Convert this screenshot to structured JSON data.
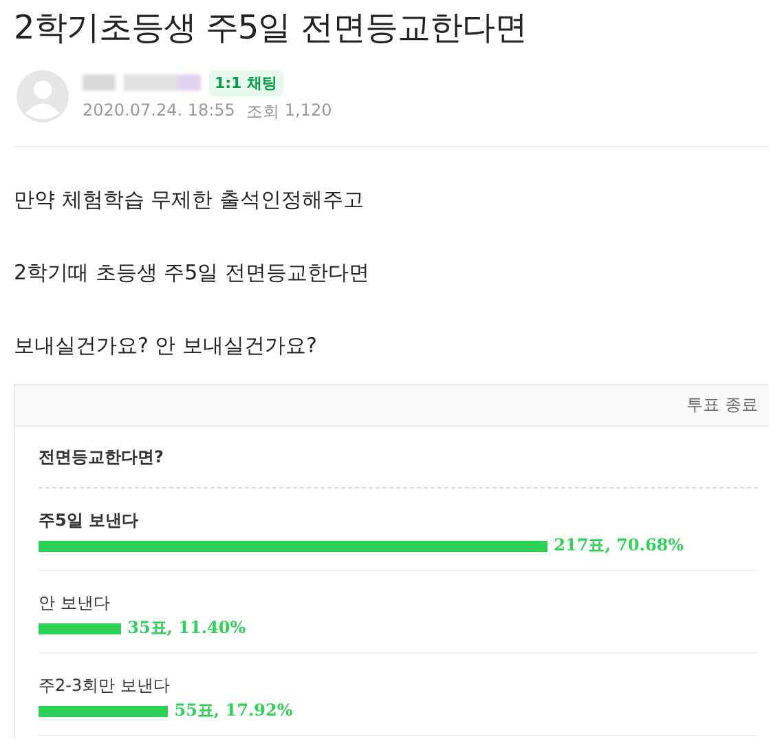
{
  "title": "2학기초등생 주5일 전면등교한다면",
  "author": {
    "chat_badge": "1:1 채팅",
    "date": "2020.07.24. 18:55",
    "views_label": "조회",
    "views": "1,120"
  },
  "body": [
    "만약 체험학습 무제한 출석인정해주고",
    "2학기때 초등생 주5일 전면등교한다면",
    "보내실건가요? 안 보내실건가요?"
  ],
  "poll": {
    "status": "투표 종료",
    "question": "전면등교한다면?",
    "options": [
      {
        "label": "주5일 보낸다",
        "level": 0.7068,
        "result": "217표, 70.68%",
        "winner": true
      },
      {
        "label": "안 보낸다",
        "level": 0.114,
        "result": "35표, 11.40%",
        "winner": false
      },
      {
        "label": "주2-3회만 보낸다",
        "level": 0.1792,
        "result": "55표, 17.92%",
        "winner": false
      }
    ]
  }
}
